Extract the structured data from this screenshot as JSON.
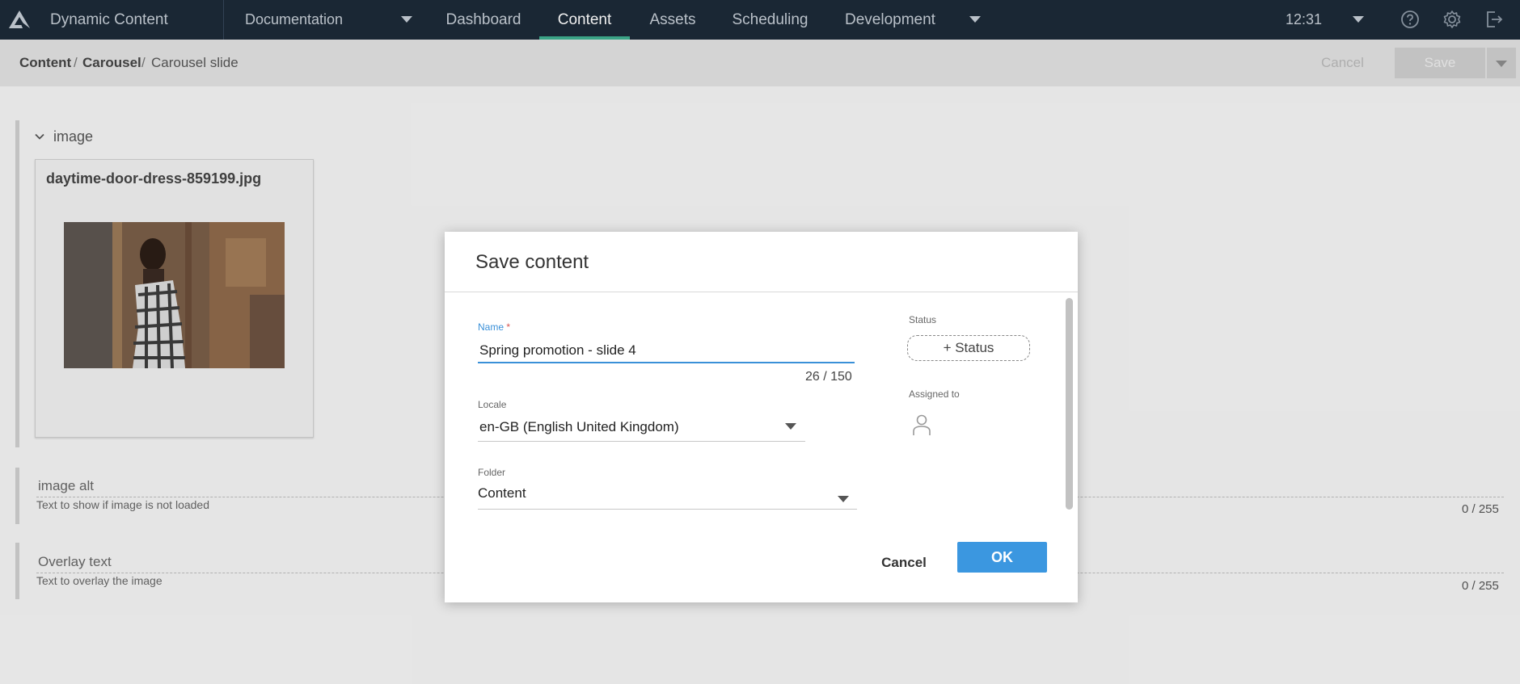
{
  "app": {
    "name": "Dynamic Content",
    "hub": "Documentation",
    "tabs": [
      {
        "label": "Dashboard"
      },
      {
        "label": "Content"
      },
      {
        "label": "Assets"
      },
      {
        "label": "Scheduling"
      },
      {
        "label": "Development"
      }
    ],
    "active_tab": "Content",
    "time": "12:31"
  },
  "breadcrumb": {
    "items": [
      "Content",
      "Carousel",
      "Carousel slide"
    ],
    "separator": "/"
  },
  "actions": {
    "cancel_label": "Cancel",
    "save_label": "Save"
  },
  "editor": {
    "image_section": {
      "title": "image",
      "file_name": "daytime-door-dress-859199.jpg"
    },
    "fields": [
      {
        "label": "image alt",
        "help": "Text to show if image is not loaded",
        "count": "0 / 255"
      },
      {
        "label": "Overlay text",
        "help": "Text to overlay the image",
        "count": "0 / 255"
      }
    ]
  },
  "dialog": {
    "title": "Save content",
    "name_label": "Name",
    "name_required_mark": "*",
    "name_value": "Spring promotion - slide 4",
    "name_count": "26 / 150",
    "locale_label": "Locale",
    "locale_value": "en-GB (English United Kingdom)",
    "folder_label": "Folder",
    "folder_value": "Content",
    "status_label": "Status",
    "status_button": "+ Status",
    "assigned_label": "Assigned to",
    "cancel_label": "Cancel",
    "ok_label": "OK"
  },
  "colors": {
    "topbar": "#1c2a38",
    "active_tab_indicator": "#3fae8f",
    "primary_button": "#3b97e0",
    "focus_accent": "#3a90d8"
  }
}
